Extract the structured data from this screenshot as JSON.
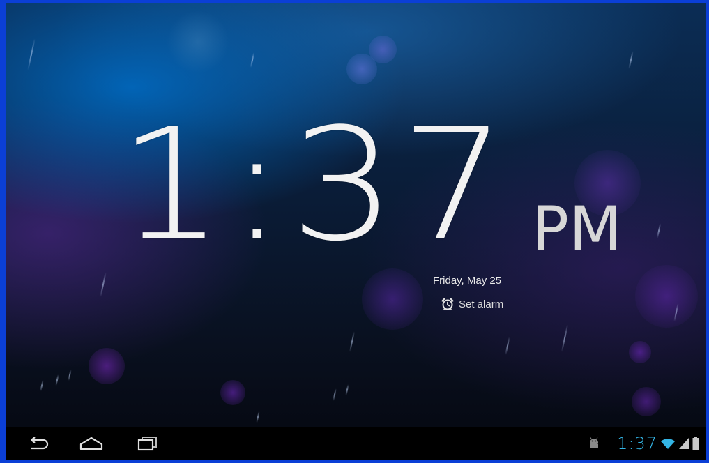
{
  "lockscreen": {
    "time": "1:37",
    "ampm": "PM",
    "date": "Friday, May 25",
    "alarm_label": "Set alarm",
    "alarm_icon": "alarm-clock-icon"
  },
  "nav_bar": {
    "back_icon": "back-icon",
    "home_icon": "home-icon",
    "recents_icon": "recent-apps-icon"
  },
  "status_bar": {
    "time": "1:37",
    "notification_icon": "android-notification-icon",
    "wifi_icon": "wifi-icon",
    "signal_icon": "signal-icon",
    "battery_icon": "battery-icon",
    "accent_color": "#33b5e5"
  },
  "colors": {
    "frame_border": "#0b3fd6",
    "clock_text": "#f2f2f2",
    "nav_background": "#000000"
  }
}
